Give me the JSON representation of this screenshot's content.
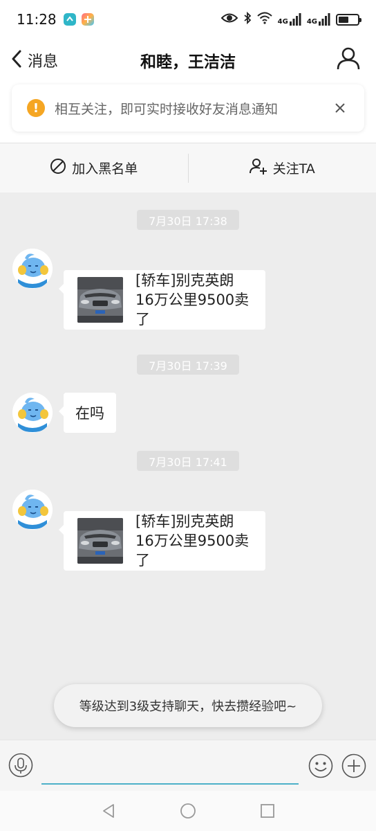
{
  "status_bar": {
    "time": "11:28",
    "app_icons": [
      "app-icon-blue",
      "app-icon-gradient"
    ],
    "icons": [
      "eye-icon",
      "bluetooth-icon",
      "wifi-icon",
      "signal-4g-icon",
      "signal-4g-icon",
      "battery-icon"
    ],
    "net_labels": [
      "4G",
      "4G"
    ],
    "battery_level": 0.55
  },
  "header": {
    "back_label": "消息",
    "title": "和睦，王洁洁",
    "profile_icon": "user-icon"
  },
  "notice": {
    "icon": "warning-icon",
    "text": "相互关注，即可实时接收好友消息通知",
    "close_icon": "close-icon"
  },
  "actions": {
    "block_label": "加入黑名单",
    "block_icon": "block-icon",
    "follow_label": "关注TA",
    "follow_icon": "add-user-icon"
  },
  "messages": [
    {
      "time": "7月30日 17:38",
      "type": "card",
      "text": "[轿车]别克英朗16万公里9500卖了"
    },
    {
      "time": "7月30日 17:39",
      "type": "text",
      "text": "在吗"
    },
    {
      "time": "7月30日 17:41",
      "type": "card",
      "text": "[轿车]别克英朗16万公里9500卖了"
    }
  ],
  "toast": "等级达到3级支持聊天，快去攒经验吧~",
  "input_bar": {
    "placeholder": "",
    "voice_icon": "microphone-icon",
    "emoji_icon": "emoji-icon",
    "plus_icon": "plus-icon"
  },
  "nav_bar": {
    "icons": [
      "back-triangle-icon",
      "home-circle-icon",
      "recent-square-icon"
    ]
  },
  "colors": {
    "chat_background": "#ededed",
    "notice_warning": "#f5a623",
    "input_underline": "#4db0c8",
    "avatar_blue": "#2f8fd8"
  }
}
